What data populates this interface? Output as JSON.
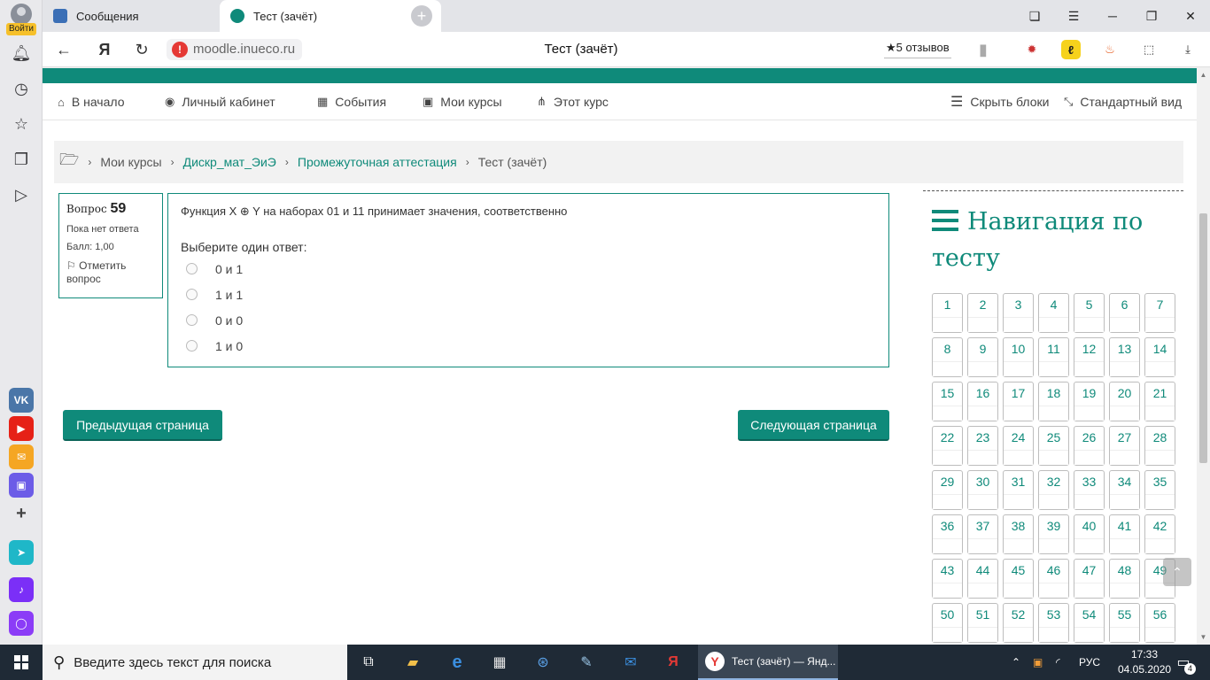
{
  "sidebar": {
    "login_label": "Войти",
    "apps": [
      {
        "name": "vk",
        "label": "VK",
        "color": "#4a76a8"
      },
      {
        "name": "youtube",
        "label": "▶",
        "color": "#e62117"
      },
      {
        "name": "mail",
        "label": "✉",
        "color": "#f5a623"
      },
      {
        "name": "messenger",
        "label": "▣",
        "color": "#6c5ce7"
      },
      {
        "name": "add",
        "label": "+",
        "color": "transparent"
      },
      {
        "name": "send",
        "label": "➤",
        "color": "#1fb7c8"
      },
      {
        "name": "music",
        "label": "♪",
        "color": "#7b2ff7"
      },
      {
        "name": "alice",
        "label": "◯",
        "color": "#8b3cf7"
      }
    ]
  },
  "tabs": [
    {
      "label": "Сообщения",
      "active": false
    },
    {
      "label": "Тест (зачёт)",
      "active": true
    }
  ],
  "address": {
    "url": "moodle.inueco.ru",
    "page_title": "Тест (зачёт)",
    "reviews": "★5 отзывов"
  },
  "topnav": {
    "home": "В начало",
    "cabinet": "Личный кабинет",
    "events": "События",
    "my_courses": "Мои курсы",
    "this_course": "Этот курс",
    "hide_blocks": "Скрыть блоки",
    "standard_view": "Стандартный вид"
  },
  "breadcrumb": {
    "items": [
      "Мои курсы",
      "Дискр_мат_ЭиЭ",
      "Промежуточная аттестация",
      "Тест (зачёт)"
    ]
  },
  "question": {
    "label": "Вопрос",
    "number": "59",
    "status": "Пока нет ответа",
    "score": "Балл: 1,00",
    "flag": "Отметить вопрос",
    "text": "Функция X ⊕ Y на наборах 01 и 11 принимает значения, соответственно",
    "prompt": "Выберите один ответ:",
    "options": [
      "0 и 1",
      "1 и 1",
      "0 и 0",
      "1 и 0"
    ]
  },
  "buttons": {
    "prev": "Предыдущая страница",
    "next": "Следующая страница"
  },
  "quiz_nav": {
    "title": "Навигация по тесту",
    "cells": [
      "1",
      "2",
      "3",
      "4",
      "5",
      "6",
      "7",
      "8",
      "9",
      "10",
      "11",
      "12",
      "13",
      "14",
      "15",
      "16",
      "17",
      "18",
      "19",
      "20",
      "21",
      "22",
      "23",
      "24",
      "25",
      "26",
      "27",
      "28",
      "29",
      "30",
      "31",
      "32",
      "33",
      "34",
      "35",
      "36",
      "37",
      "38",
      "39",
      "40",
      "41",
      "42",
      "43",
      "44",
      "45",
      "46",
      "47",
      "48",
      "49",
      "50",
      "51",
      "52",
      "53",
      "54",
      "55",
      "56"
    ]
  },
  "taskbar": {
    "search_placeholder": "Введите здесь текст для поиска",
    "running_window": "Тест (зачёт) — Янд...",
    "lang": "РУС",
    "time": "17:33",
    "date": "04.05.2020",
    "notifications": "4"
  },
  "colors": {
    "accent": "#0f8a7a"
  }
}
